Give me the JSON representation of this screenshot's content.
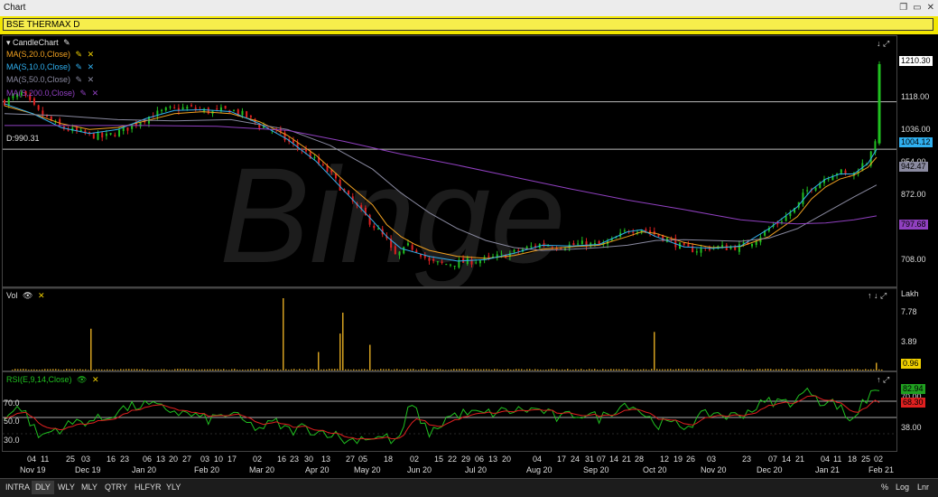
{
  "window": {
    "title": "Chart"
  },
  "header": {
    "symbol": "BSE THERMAX D"
  },
  "legend": {
    "items": [
      {
        "label": "CandleChart",
        "color": "#e0e0e0"
      },
      {
        "label": "MA(S,20.0,Close)",
        "color": "#f0a020"
      },
      {
        "label": "MA(S,10.0,Close)",
        "color": "#30b0f0"
      },
      {
        "label": "MA(S,50.0,Close)",
        "color": "#8a8aa0"
      },
      {
        "label": "MA(S,200.0,Close)",
        "color": "#9040c0"
      }
    ],
    "level_label": "D:990.31"
  },
  "price_axis": {
    "ticks": [
      "1118.00",
      "1036.00",
      "954.00",
      "872.00",
      "790.00",
      "708.00"
    ]
  },
  "price_tags": [
    {
      "value": "1210.30",
      "bg": "#ffffff",
      "fg": "#000000"
    },
    {
      "value": "1004.12",
      "bg": "#30b0f0",
      "fg": "#000000"
    },
    {
      "value": "942.47",
      "bg": "#8a8aa0",
      "fg": "#000000"
    },
    {
      "value": "797.68",
      "bg": "#9040c0",
      "fg": "#000000"
    }
  ],
  "volume": {
    "label": "Vol",
    "unit": "Lakh",
    "ticks": [
      "7.78",
      "3.89"
    ],
    "last": "0.96"
  },
  "rsi": {
    "label": "RSI(E,9,14,Close)",
    "levels": [
      "70.0",
      "50.0",
      "30.0"
    ],
    "axis_ticks": [
      "70.00",
      "38.00"
    ],
    "tag_green": "82.94",
    "tag_red": "68.30"
  },
  "watermark": "Binge",
  "time_axis": {
    "days": [
      {
        "x": 30,
        "d": "04"
      },
      {
        "x": 45,
        "d": "11"
      },
      {
        "x": 73,
        "d": "25"
      },
      {
        "x": 90,
        "d": "03"
      },
      {
        "x": 118,
        "d": "16"
      },
      {
        "x": 133,
        "d": "23"
      },
      {
        "x": 158,
        "d": "06"
      },
      {
        "x": 173,
        "d": "13"
      },
      {
        "x": 187,
        "d": "20"
      },
      {
        "x": 202,
        "d": "27"
      },
      {
        "x": 222,
        "d": "03"
      },
      {
        "x": 237,
        "d": "10"
      },
      {
        "x": 252,
        "d": "17"
      },
      {
        "x": 280,
        "d": "02"
      },
      {
        "x": 307,
        "d": "16"
      },
      {
        "x": 321,
        "d": "23"
      },
      {
        "x": 337,
        "d": "30"
      },
      {
        "x": 356,
        "d": "13"
      },
      {
        "x": 383,
        "d": "27"
      },
      {
        "x": 397,
        "d": "05"
      },
      {
        "x": 425,
        "d": "18"
      },
      {
        "x": 454,
        "d": "02"
      },
      {
        "x": 481,
        "d": "15"
      },
      {
        "x": 496,
        "d": "22"
      },
      {
        "x": 511,
        "d": "29"
      },
      {
        "x": 526,
        "d": "06"
      },
      {
        "x": 541,
        "d": "13"
      },
      {
        "x": 556,
        "d": "20"
      },
      {
        "x": 590,
        "d": "04"
      },
      {
        "x": 617,
        "d": "17"
      },
      {
        "x": 632,
        "d": "24"
      },
      {
        "x": 648,
        "d": "31"
      },
      {
        "x": 661,
        "d": "07"
      },
      {
        "x": 675,
        "d": "14"
      },
      {
        "x": 689,
        "d": "21"
      },
      {
        "x": 703,
        "d": "28"
      },
      {
        "x": 731,
        "d": "12"
      },
      {
        "x": 746,
        "d": "19"
      },
      {
        "x": 760,
        "d": "26"
      },
      {
        "x": 783,
        "d": "03"
      },
      {
        "x": 822,
        "d": "23"
      },
      {
        "x": 851,
        "d": "07"
      },
      {
        "x": 866,
        "d": "14"
      },
      {
        "x": 881,
        "d": "21"
      },
      {
        "x": 909,
        "d": "04"
      },
      {
        "x": 923,
        "d": "11"
      },
      {
        "x": 939,
        "d": "18"
      },
      {
        "x": 954,
        "d": "25"
      },
      {
        "x": 968,
        "d": "02"
      }
    ],
    "months": [
      {
        "x": 22,
        "m": "Nov 19"
      },
      {
        "x": 83,
        "m": "Dec 19"
      },
      {
        "x": 146,
        "m": "Jan 20"
      },
      {
        "x": 215,
        "m": "Feb 20"
      },
      {
        "x": 276,
        "m": "Mar 20"
      },
      {
        "x": 338,
        "m": "Apr 20"
      },
      {
        "x": 392,
        "m": "May 20"
      },
      {
        "x": 451,
        "m": "Jun 20"
      },
      {
        "x": 515,
        "m": "Jul 20"
      },
      {
        "x": 583,
        "m": "Aug 20"
      },
      {
        "x": 646,
        "m": "Sep 20"
      },
      {
        "x": 712,
        "m": "Oct 20"
      },
      {
        "x": 776,
        "m": "Nov 20"
      },
      {
        "x": 838,
        "m": "Dec 20"
      },
      {
        "x": 903,
        "m": "Jan 21"
      },
      {
        "x": 962,
        "m": "Feb 21"
      }
    ]
  },
  "timeframes": [
    "INTRA",
    "DLY",
    "WLY",
    "MLY",
    "QTRY",
    "HLFYR",
    "YLY"
  ],
  "active_timeframe": "DLY",
  "bottom_right": {
    "pct": "%",
    "log": "Log",
    "lnr": "Lnr"
  },
  "colors": {
    "up": "#20c020",
    "down": "#e02020",
    "volume": "#d4a020",
    "rsi_line": "#20c020",
    "rsi_signal": "#e02020"
  },
  "chart_data": {
    "type": "candlestick",
    "title": "BSE THERMAX D",
    "x_range": [
      "Nov 19",
      "Feb 21"
    ],
    "ylim": [
      660,
      1230
    ],
    "horizontal_lines": [
      1110,
      990.31
    ],
    "close_path": [
      [
        0,
        1110
      ],
      [
        12,
        1130
      ],
      [
        25,
        1080
      ],
      [
        40,
        1045
      ],
      [
        55,
        1030
      ],
      [
        70,
        1020
      ],
      [
        85,
        1040
      ],
      [
        100,
        1070
      ],
      [
        115,
        1090
      ],
      [
        130,
        1095
      ],
      [
        145,
        1085
      ],
      [
        160,
        1090
      ],
      [
        170,
        1075
      ],
      [
        180,
        1050
      ],
      [
        190,
        1040
      ],
      [
        200,
        1010
      ],
      [
        210,
        990
      ],
      [
        220,
        960
      ],
      [
        230,
        930
      ],
      [
        240,
        880
      ],
      [
        250,
        840
      ],
      [
        260,
        800
      ],
      [
        270,
        760
      ],
      [
        275,
        720
      ],
      [
        280,
        730
      ],
      [
        285,
        745
      ],
      [
        290,
        740
      ],
      [
        295,
        725
      ],
      [
        300,
        705
      ],
      [
        310,
        700
      ],
      [
        320,
        704
      ],
      [
        330,
        708
      ],
      [
        340,
        712
      ],
      [
        350,
        720
      ],
      [
        360,
        730
      ],
      [
        370,
        742
      ],
      [
        380,
        752
      ],
      [
        390,
        745
      ],
      [
        400,
        748
      ],
      [
        410,
        752
      ],
      [
        420,
        747
      ],
      [
        430,
        760
      ],
      [
        440,
        786
      ],
      [
        450,
        790
      ],
      [
        460,
        775
      ],
      [
        470,
        760
      ],
      [
        480,
        740
      ],
      [
        490,
        736
      ],
      [
        500,
        744
      ],
      [
        510,
        742
      ],
      [
        520,
        745
      ],
      [
        530,
        762
      ],
      [
        540,
        790
      ],
      [
        550,
        815
      ],
      [
        560,
        845
      ],
      [
        565,
        880
      ],
      [
        570,
        895
      ],
      [
        575,
        905
      ],
      [
        580,
        920
      ],
      [
        585,
        930
      ],
      [
        590,
        935
      ],
      [
        595,
        920
      ],
      [
        600,
        930
      ],
      [
        605,
        950
      ],
      [
        610,
        960
      ],
      [
        612,
        990
      ],
      [
        614,
        1000
      ],
      [
        616,
        1004
      ]
    ],
    "series": [
      {
        "name": "MA(S,20.0,Close)",
        "values": [
          [
            0,
            1100
          ],
          [
            20,
            1080
          ],
          [
            40,
            1055
          ],
          [
            60,
            1040
          ],
          [
            80,
            1045
          ],
          [
            100,
            1062
          ],
          [
            120,
            1080
          ],
          [
            140,
            1085
          ],
          [
            160,
            1080
          ],
          [
            180,
            1060
          ],
          [
            200,
            1025
          ],
          [
            220,
            975
          ],
          [
            240,
            910
          ],
          [
            260,
            850
          ],
          [
            270,
            800
          ],
          [
            280,
            770
          ],
          [
            290,
            750
          ],
          [
            300,
            735
          ],
          [
            320,
            720
          ],
          [
            340,
            715
          ],
          [
            360,
            722
          ],
          [
            380,
            738
          ],
          [
            400,
            744
          ],
          [
            420,
            748
          ],
          [
            440,
            770
          ],
          [
            450,
            782
          ],
          [
            460,
            778
          ],
          [
            480,
            755
          ],
          [
            500,
            742
          ],
          [
            520,
            745
          ],
          [
            540,
            770
          ],
          [
            560,
            820
          ],
          [
            570,
            865
          ],
          [
            580,
            895
          ],
          [
            590,
            915
          ],
          [
            600,
            925
          ],
          [
            610,
            945
          ],
          [
            616,
            970
          ]
        ]
      },
      {
        "name": "MA(S,10.0,Close)",
        "values": [
          [
            0,
            1105
          ],
          [
            20,
            1080
          ],
          [
            40,
            1045
          ],
          [
            60,
            1030
          ],
          [
            80,
            1040
          ],
          [
            100,
            1068
          ],
          [
            120,
            1088
          ],
          [
            140,
            1090
          ],
          [
            160,
            1085
          ],
          [
            180,
            1055
          ],
          [
            200,
            1015
          ],
          [
            220,
            960
          ],
          [
            240,
            885
          ],
          [
            260,
            810
          ],
          [
            270,
            770
          ],
          [
            280,
            740
          ],
          [
            290,
            730
          ],
          [
            300,
            720
          ],
          [
            320,
            708
          ],
          [
            340,
            712
          ],
          [
            360,
            728
          ],
          [
            380,
            748
          ],
          [
            400,
            746
          ],
          [
            420,
            750
          ],
          [
            440,
            782
          ],
          [
            450,
            787
          ],
          [
            460,
            770
          ],
          [
            480,
            744
          ],
          [
            500,
            740
          ],
          [
            520,
            746
          ],
          [
            540,
            790
          ],
          [
            560,
            845
          ],
          [
            570,
            888
          ],
          [
            580,
            915
          ],
          [
            590,
            928
          ],
          [
            600,
            928
          ],
          [
            610,
            955
          ],
          [
            616,
            990
          ]
        ]
      },
      {
        "name": "MA(S,50.0,Close)",
        "values": [
          [
            0,
            1080
          ],
          [
            40,
            1075
          ],
          [
            80,
            1065
          ],
          [
            120,
            1062
          ],
          [
            160,
            1065
          ],
          [
            200,
            1040
          ],
          [
            230,
            1000
          ],
          [
            260,
            940
          ],
          [
            280,
            880
          ],
          [
            300,
            830
          ],
          [
            320,
            790
          ],
          [
            340,
            760
          ],
          [
            360,
            742
          ],
          [
            380,
            735
          ],
          [
            400,
            738
          ],
          [
            420,
            742
          ],
          [
            440,
            748
          ],
          [
            460,
            760
          ],
          [
            480,
            762
          ],
          [
            500,
            760
          ],
          [
            520,
            758
          ],
          [
            540,
            766
          ],
          [
            560,
            790
          ],
          [
            580,
            830
          ],
          [
            600,
            870
          ],
          [
            616,
            900
          ]
        ]
      },
      {
        "name": "MA(S,200.0,Close)",
        "values": [
          [
            0,
            1050
          ],
          [
            50,
            1050
          ],
          [
            100,
            1050
          ],
          [
            150,
            1048
          ],
          [
            200,
            1038
          ],
          [
            240,
            1010
          ],
          [
            280,
            978
          ],
          [
            320,
            950
          ],
          [
            360,
            920
          ],
          [
            400,
            890
          ],
          [
            440,
            862
          ],
          [
            480,
            838
          ],
          [
            500,
            825
          ],
          [
            520,
            812
          ],
          [
            540,
            806
          ],
          [
            560,
            802
          ],
          [
            580,
            804
          ],
          [
            600,
            812
          ],
          [
            616,
            822
          ]
        ]
      }
    ]
  }
}
